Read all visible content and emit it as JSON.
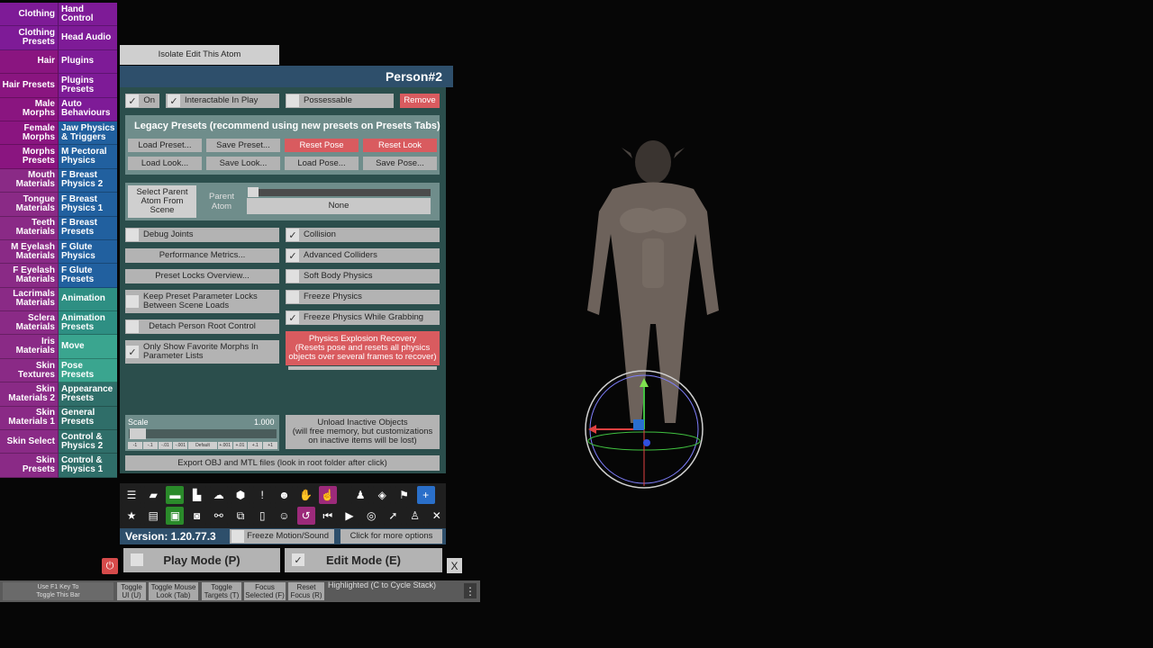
{
  "tabs": [
    {
      "left": "Clothing",
      "right": "Hand\nControl",
      "lc": "#7e1b97",
      "rc": "#7e1b97"
    },
    {
      "left": "Clothing\nPresets",
      "right": "Head Audio",
      "lc": "#7e1b97",
      "rc": "#7e1b97"
    },
    {
      "left": "Hair",
      "right": "Plugins",
      "lc": "#8a1580",
      "rc": "#7e1b97"
    },
    {
      "left": "Hair Presets",
      "right": "Plugins\nPresets",
      "lc": "#8a1580",
      "rc": "#7e1b97"
    },
    {
      "left": "Male\nMorphs",
      "right": "Auto\nBehaviours",
      "lc": "#8a1580",
      "rc": "#7e1b97"
    },
    {
      "left": "Female\nMorphs",
      "right": "Jaw Physics\n& Triggers",
      "lc": "#8a1580",
      "rc": "#21609f"
    },
    {
      "left": "Morphs\nPresets",
      "right": "M Pectoral\nPhysics",
      "lc": "#8a1580",
      "rc": "#21609f"
    },
    {
      "left": "Mouth\nMaterials",
      "right": "F Breast\nPhysics 2",
      "lc": "#8a2a86",
      "rc": "#21609f"
    },
    {
      "left": "Tongue\nMaterials",
      "right": "F Breast\nPhysics 1",
      "lc": "#8a2a86",
      "rc": "#21609f"
    },
    {
      "left": "Teeth\nMaterials",
      "right": "F Breast\nPresets",
      "lc": "#8a2a86",
      "rc": "#21609f"
    },
    {
      "left": "M Eyelash\nMaterials",
      "right": "F Glute\nPhysics",
      "lc": "#8a2a86",
      "rc": "#21609f"
    },
    {
      "left": "F Eyelash\nMaterials",
      "right": "F Glute\nPresets",
      "lc": "#8a2a86",
      "rc": "#21609f"
    },
    {
      "left": "Lacrimals\nMaterials",
      "right": "Animation",
      "lc": "#8a2a86",
      "rc": "#2e8f83"
    },
    {
      "left": "Sclera\nMaterials",
      "right": "Animation\nPresets",
      "lc": "#8a2a86",
      "rc": "#2e8f83"
    },
    {
      "left": "Iris\nMaterials",
      "right": "Move",
      "lc": "#8a2a86",
      "rc": "#3aa58f"
    },
    {
      "left": "Skin\nTextures",
      "right": "Pose\nPresets",
      "lc": "#8a2a86",
      "rc": "#3aa58f"
    },
    {
      "left": "Skin\nMaterials 2",
      "right": "Appearance\nPresets",
      "lc": "#8a2a86",
      "rc": "#2f6e69"
    },
    {
      "left": "Skin\nMaterials 1",
      "right": "General\nPresets",
      "lc": "#8a2a86",
      "rc": "#2f6e69"
    },
    {
      "left": "Skin Select",
      "right": "Control &\nPhysics 2",
      "lc": "#8a2a86",
      "rc": "#2f6e69"
    },
    {
      "left": "Skin\nPresets",
      "right": "Control &\nPhysics 1",
      "lc": "#8a2a86",
      "rc": "#2f6e69"
    }
  ],
  "isolate": "Isolate Edit This Atom",
  "panel": {
    "title": "Person#2",
    "on": "On",
    "interactable": "Interactable In Play",
    "possessable": "Possessable",
    "remove": "Remove",
    "legacy": "Legacy Presets (recommend using new presets on Presets Tabs)",
    "load_preset": "Load Preset...",
    "save_preset": "Save Preset...",
    "reset_pose": "Reset Pose",
    "reset_look": "Reset Look",
    "load_look": "Load Look...",
    "save_look": "Save Look...",
    "load_pose": "Load Pose...",
    "save_pose": "Save Pose...",
    "select_parent": "Select Parent\nAtom From\nScene",
    "parent_atom": "Parent\nAtom",
    "none": "None",
    "debug_joints": "Debug Joints",
    "collision": "Collision",
    "perf": "Performance Metrics...",
    "adv_colliders": "Advanced Colliders",
    "preset_locks": "Preset Locks Overview...",
    "soft_body": "Soft Body Physics",
    "keep_locks": "Keep Preset Parameter Locks\nBetween Scene Loads",
    "freeze_physics": "Freeze Physics",
    "freeze_grab": "Freeze Physics While Grabbing",
    "detach": "Detach Person Root Control",
    "explosion": "Physics Explosion Recovery\n(Resets pose and resets all physics\nobjects over several frames to recover)",
    "only_fav": "Only Show Favorite Morphs In\nParameter Lists",
    "scale": "Scale",
    "scale_val": "1.000",
    "scale_steps": [
      "-1",
      "-.1",
      "-.01",
      "-.001",
      "Default",
      "+.001",
      "+.01",
      "+.1",
      "+1"
    ],
    "unload": "Unload Inactive Objects\n(will free memory, but customizations\non inactive items will be lost)",
    "export": "Export OBJ and MTL files (look in root folder after click)"
  },
  "toolbar": {
    "row1": [
      {
        "name": "menu-icon",
        "g": "☰",
        "c": "#1f1f1f"
      },
      {
        "name": "open-scene-icon",
        "g": "▰",
        "c": "#1f1f1f"
      },
      {
        "name": "folder-icon",
        "g": "▬",
        "c": "#2a8a2a"
      },
      {
        "name": "save-icon",
        "g": "▙",
        "c": "#1f1f1f"
      },
      {
        "name": "cloud-icon",
        "g": "☁",
        "c": "#1f1f1f"
      },
      {
        "name": "package-icon",
        "g": "⬢",
        "c": "#1f1f1f"
      },
      {
        "name": "alert-icon",
        "g": "!",
        "c": "#1f1f1f"
      },
      {
        "name": "person-select-icon",
        "g": "☻",
        "c": "#1f1f1f"
      },
      {
        "name": "hand-icon",
        "g": "✋",
        "c": "#1f1f1f"
      },
      {
        "name": "hand-point-icon",
        "g": "☝",
        "c": "#9c2a7a"
      },
      {
        "name": "person-icon",
        "g": "♟",
        "c": "#1f1f1f"
      },
      {
        "name": "vr-icon",
        "g": "◈",
        "c": "#1f1f1f"
      },
      {
        "name": "flag-icon",
        "g": "⚑",
        "c": "#1f1f1f"
      },
      {
        "name": "add-icon",
        "g": "+",
        "c": "#2a6fc9"
      }
    ],
    "row2": [
      {
        "name": "star-icon",
        "g": "★",
        "c": "#1f1f1f"
      },
      {
        "name": "load-scene-icon",
        "g": "▤",
        "c": "#1f1f1f"
      },
      {
        "name": "screenshot-icon",
        "g": "▣",
        "c": "#2a8a2a"
      },
      {
        "name": "camera-icon",
        "g": "◙",
        "c": "#1f1f1f"
      },
      {
        "name": "nodes-icon",
        "g": "⚯",
        "c": "#1f1f1f"
      },
      {
        "name": "layers-icon",
        "g": "⧉",
        "c": "#1f1f1f"
      },
      {
        "name": "document-icon",
        "g": "▯",
        "c": "#1f1f1f"
      },
      {
        "name": "person-edit-icon",
        "g": "☺",
        "c": "#1f1f1f"
      },
      {
        "name": "undo-icon",
        "g": "↺",
        "c": "#9c2a7a"
      },
      {
        "name": "skip-back-icon",
        "g": "⏮",
        "c": "#1f1f1f"
      },
      {
        "name": "play-icon",
        "g": "▶",
        "c": "#1f1f1f"
      },
      {
        "name": "target-icon",
        "g": "◎",
        "c": "#1f1f1f"
      },
      {
        "name": "cursor-icon",
        "g": "➚",
        "c": "#1f1f1f"
      },
      {
        "name": "people-icon",
        "g": "♙",
        "c": "#1f1f1f"
      },
      {
        "name": "tools-icon",
        "g": "✕",
        "c": "#1f1f1f"
      }
    ]
  },
  "version": "Version: 1.20.77.3",
  "freeze_motion": "Freeze Motion/Sound",
  "more_options": "Click for more options",
  "play_mode": "Play Mode (P)",
  "edit_mode": "Edit Mode (E)",
  "close": "X",
  "bottom": {
    "f1": "Use F1 Key To\nToggle This Bar",
    "toggle_ui": "Toggle\nUI (U)",
    "toggle_mouse": "Toggle Mouse\nLook (Tab)",
    "toggle_targets": "Toggle\nTargets (T)",
    "focus_selected": "Focus\nSelected (F)",
    "reset_focus": "Reset\nFocus (R)",
    "highlighted": "Highlighted (C to Cycle Stack)",
    "more_dots": "⋮"
  }
}
